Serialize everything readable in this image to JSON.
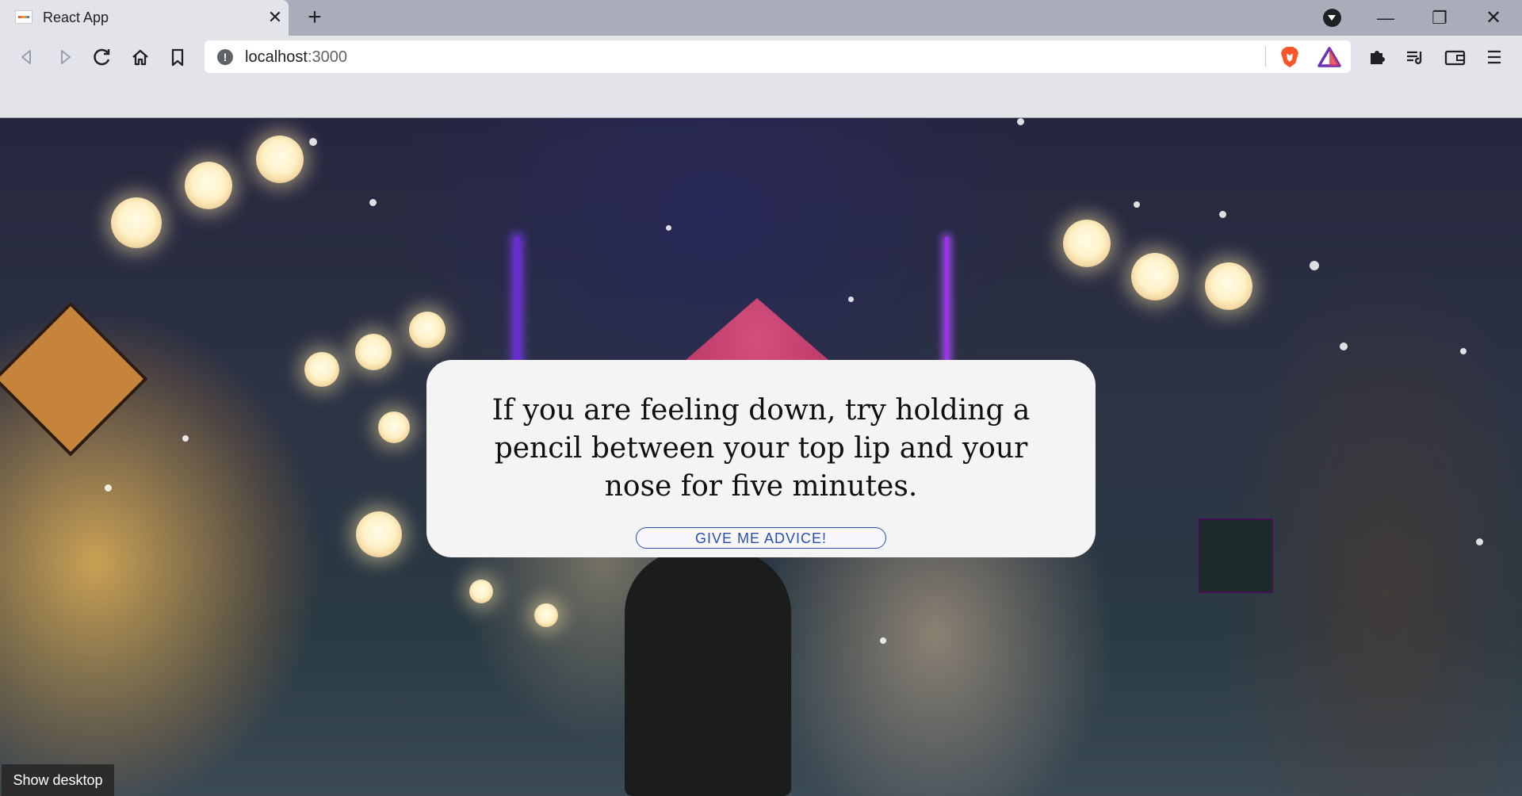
{
  "browser": {
    "tab": {
      "title": "React App",
      "favicon": "react-app-favicon-icon"
    },
    "address_bar": {
      "host": "localhost",
      "port": ":3000"
    },
    "icons": [
      "back-icon",
      "forward-icon",
      "reload-icon",
      "home-icon",
      "bookmark-icon",
      "site-info-icon",
      "brave-shields-icon",
      "brave-rewards-icon",
      "extensions-icon",
      "playlist-icon",
      "wallet-icon",
      "menu-icon"
    ],
    "window_buttons": {
      "minimize": "—",
      "restore": "❐",
      "close": "✕"
    }
  },
  "page": {
    "advice_text": "If you are feeling down, try holding a pencil between your top lip and your nose for five minutes.",
    "button_label": "GIVE ME ADVICE!",
    "colors": {
      "card_bg": "#f4f4f4",
      "button_border": "#2b4fa8"
    }
  },
  "taskbar": {
    "show_desktop_label": "Show desktop"
  }
}
